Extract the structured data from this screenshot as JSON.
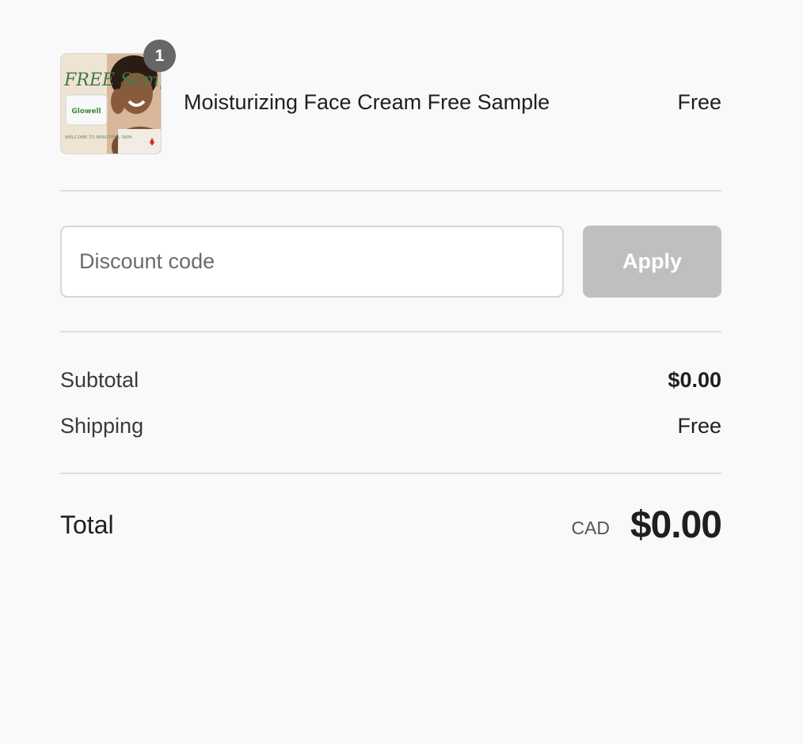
{
  "product": {
    "name": "Moisturizing Face Cream Free Sample",
    "price": "Free",
    "quantity": "1",
    "thumbnail": {
      "script_text": "FREE Sample",
      "package_text": "Glowell",
      "caption": "WELCOME TO BEAUTIFUL SKIN"
    }
  },
  "discount": {
    "placeholder": "Discount code",
    "value": "",
    "apply_label": "Apply"
  },
  "totals": {
    "subtotal_label": "Subtotal",
    "subtotal_value": "$0.00",
    "shipping_label": "Shipping",
    "shipping_value": "Free",
    "total_label": "Total",
    "currency": "CAD",
    "total_value": "$0.00"
  },
  "colors": {
    "background": "#f9f9f9",
    "badge": "#666666",
    "apply_disabled": "#bfbfbf",
    "divider": "#dedede"
  }
}
